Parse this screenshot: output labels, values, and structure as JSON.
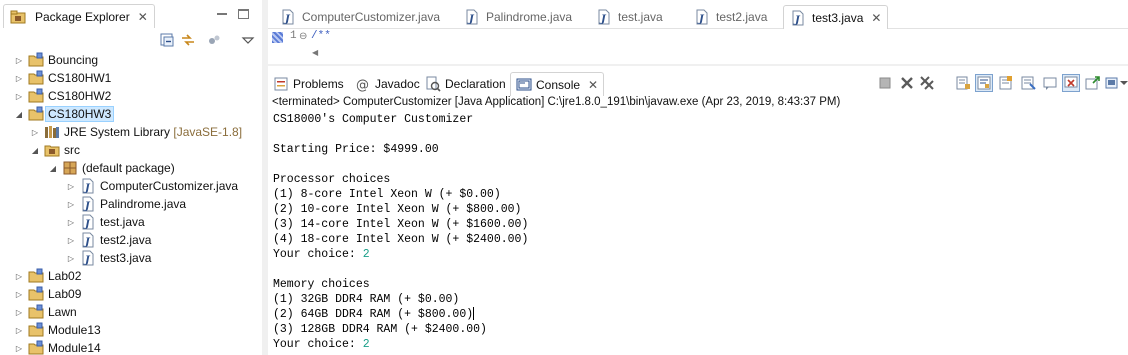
{
  "package_explorer": {
    "title": "Package Explorer",
    "tree": [
      {
        "label": "Bouncing",
        "icon": "project-folder-icon",
        "expanded": false,
        "indent": 0
      },
      {
        "label": "CS180HW1",
        "icon": "project-folder-icon",
        "expanded": false,
        "indent": 0
      },
      {
        "label": "CS180HW2",
        "icon": "project-folder-icon",
        "expanded": false,
        "indent": 0
      },
      {
        "label": "CS180HW3",
        "icon": "project-folder-icon",
        "expanded": true,
        "indent": 0,
        "selected": true
      },
      {
        "label": "JRE System Library",
        "suffix": "[JavaSE-1.8]",
        "icon": "library-icon",
        "expanded": false,
        "indent": 1
      },
      {
        "label": "src",
        "icon": "source-folder-icon",
        "expanded": true,
        "indent": 1
      },
      {
        "label": "(default package)",
        "icon": "package-icon",
        "expanded": true,
        "indent": 2
      },
      {
        "label": "ComputerCustomizer.java",
        "icon": "java-file-icon",
        "expanded": false,
        "indent": 3
      },
      {
        "label": "Palindrome.java",
        "icon": "java-file-icon",
        "expanded": false,
        "indent": 3
      },
      {
        "label": "test.java",
        "icon": "java-file-icon",
        "expanded": false,
        "indent": 3
      },
      {
        "label": "test2.java",
        "icon": "java-file-icon",
        "expanded": false,
        "indent": 3
      },
      {
        "label": "test3.java",
        "icon": "java-file-icon",
        "expanded": false,
        "indent": 3
      },
      {
        "label": "Lab02",
        "icon": "project-folder-icon",
        "expanded": false,
        "indent": 0
      },
      {
        "label": "Lab09",
        "icon": "project-folder-icon",
        "expanded": false,
        "indent": 0
      },
      {
        "label": "Lawn",
        "icon": "project-folder-icon",
        "expanded": false,
        "indent": 0
      },
      {
        "label": "Module13",
        "icon": "project-folder-icon",
        "expanded": false,
        "indent": 0
      },
      {
        "label": "Module14",
        "icon": "project-folder-icon",
        "expanded": false,
        "indent": 0
      }
    ]
  },
  "editor": {
    "tabs": [
      {
        "label": "ComputerCustomizer.java",
        "active": false
      },
      {
        "label": "Palindrome.java",
        "active": false
      },
      {
        "label": "test.java",
        "active": false
      },
      {
        "label": "test2.java",
        "active": false
      },
      {
        "label": "test3.java",
        "active": true
      }
    ],
    "line_number": "1",
    "code_line": "/**"
  },
  "console_view": {
    "tabs": [
      {
        "label": "Problems",
        "icon": "problems-icon",
        "active": false
      },
      {
        "label": "Javadoc",
        "icon": "javadoc-icon",
        "active": false
      },
      {
        "label": "Declaration",
        "icon": "declaration-icon",
        "active": false
      },
      {
        "label": "Console",
        "icon": "console-icon",
        "active": true
      }
    ],
    "status": "<terminated> ComputerCustomizer [Java Application] C:\\jre1.8.0_191\\bin\\javaw.exe (Apr 23, 2019, 8:43:37 PM)",
    "lines": [
      {
        "text": "CS18000's Computer Customizer"
      },
      {
        "text": ""
      },
      {
        "text": "Starting Price: $4999.00"
      },
      {
        "text": ""
      },
      {
        "text": "Processor choices"
      },
      {
        "text": "(1) 8-core Intel Xeon W (+ $0.00)"
      },
      {
        "text": "(2) 10-core Intel Xeon W (+ $800.00)"
      },
      {
        "text": "(3) 14-core Intel Xeon W (+ $1600.00)"
      },
      {
        "text": "(4) 18-core Intel Xeon W (+ $2400.00)"
      },
      {
        "text": "Your choice: ",
        "input": "2"
      },
      {
        "text": ""
      },
      {
        "text": "Memory choices"
      },
      {
        "text": "(1) 32GB DDR4 RAM (+ $0.00)"
      },
      {
        "text": "(2) 64GB DDR4 RAM (+ $800.00)",
        "caret": true
      },
      {
        "text": "(3) 128GB DDR4 RAM (+ $2400.00)"
      },
      {
        "text": "Your choice: ",
        "input": "2"
      }
    ]
  },
  "colors": {
    "selection_bg": "#cde8ff",
    "console_input": "#1ca08a",
    "javadoc_comment": "#3f5fbf"
  }
}
